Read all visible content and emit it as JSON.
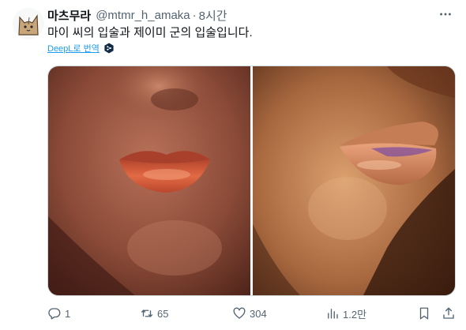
{
  "tweet": {
    "display_name": "마츠무라",
    "handle": "@mtmr_h_amaka",
    "separator": "·",
    "time": "8시간",
    "text": "마이 씨의 입술과 제이미 군의 입술입니다.",
    "translate_label": "DeepL로 번역"
  },
  "actions": {
    "replies": "1",
    "retweets": "65",
    "likes": "304",
    "views": "1.2만"
  },
  "colors": {
    "accent": "#1d9bf0",
    "text_primary": "#0f1419",
    "text_secondary": "#536471",
    "deepl": "#0f2b46"
  },
  "icons": [
    "cat-avatar-icon",
    "more-icon",
    "deepl-icon",
    "reply-icon",
    "retweet-icon",
    "like-icon",
    "views-icon",
    "bookmark-icon",
    "share-icon"
  ]
}
